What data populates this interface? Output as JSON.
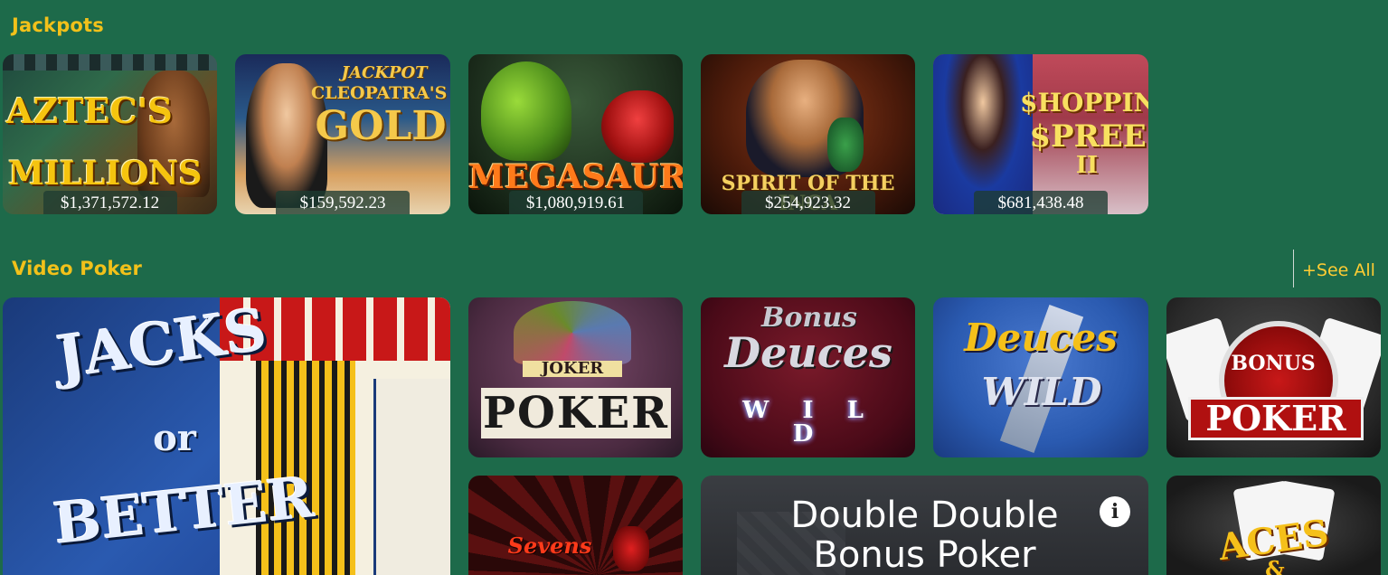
{
  "jackpots": {
    "title": "Jackpots",
    "games": [
      {
        "name": "AZTEC'S MILLIONS",
        "art_line1": "AZTEC'S",
        "art_line2": "MILLIONS",
        "amount": "$1,371,572.12"
      },
      {
        "name": "JACKPOT CLEOPATRA'S GOLD",
        "art_line1": "JACKPOT",
        "art_line2": "CLEOPATRA'S",
        "art_line3": "GOLD",
        "amount": "$159,592.23"
      },
      {
        "name": "MEGASAUR",
        "art_line1": "MEGASAUR",
        "amount": "$1,080,919.61"
      },
      {
        "name": "SPIRIT OF THE INCA",
        "art_line1": "SPIRIT OF THE INCA",
        "amount": "$254,923.32"
      },
      {
        "name": "SHOPPING SPREE II",
        "art_line1": "$HOPPING",
        "art_line2": "$PREE",
        "art_line3": "II",
        "amount": "$681,438.48"
      }
    ]
  },
  "video_poker": {
    "title": "Video Poker",
    "see_all": "+See All",
    "games": [
      {
        "name": "JACKS or BETTER",
        "art_line1": "JACKS",
        "art_line2": "or",
        "art_line3": "BETTER"
      },
      {
        "name": "JOKER POKER",
        "art_line1": "JOKER",
        "art_line2": "POKER"
      },
      {
        "name": "Bonus Deuces WILD",
        "art_line1": "Bonus",
        "art_line2": "Deuces",
        "art_line3": "W I L D"
      },
      {
        "name": "Deuces WILD",
        "art_line1": "Deuces",
        "art_line2": "WILD"
      },
      {
        "name": "BONUS POKER",
        "art_line1": "BONUS",
        "art_line2": "POKER"
      },
      {
        "name": "Sevens",
        "art_line1": "Sevens"
      },
      {
        "name": "Double Double Bonus Poker",
        "title_line1": "Double Double",
        "title_line2": "Bonus Poker"
      },
      {
        "name": "ACES &",
        "art_line1": "ACES",
        "art_line2": "&"
      }
    ]
  },
  "colors": {
    "background": "#1d6a4a",
    "section_title": "#f2c11a",
    "see_all": "#ffcc33"
  },
  "icons": {
    "info": "info-icon"
  }
}
